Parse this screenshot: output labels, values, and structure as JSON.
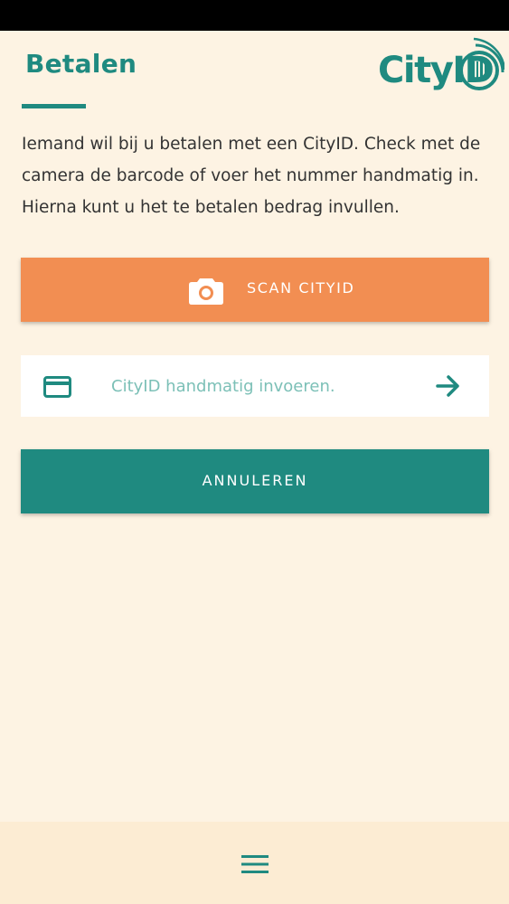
{
  "header": {
    "title": "Betalen",
    "logo_text": "CityID"
  },
  "intro_text": "Iemand wil bij u betalen met een CityID. Check met de camera de barcode of voer het nummer handmatig in. Hierna kunt u het te betalen bedrag invullen.",
  "scan_button": {
    "label": "SCAN CITYID",
    "icon": "camera-icon"
  },
  "manual_entry": {
    "placeholder": "CityID handmatig invoeren.",
    "value": "",
    "leading_icon": "credit-card-icon",
    "submit_icon": "arrow-right-icon"
  },
  "cancel_button": {
    "label": "ANNULEREN"
  },
  "bottom_bar": {
    "menu_icon": "hamburger-menu-icon"
  },
  "colors": {
    "background": "#fdf3e3",
    "primary_teal": "#1f8a80",
    "accent_orange": "#f28e52",
    "placeholder_teal": "#7cc0b7",
    "bottom_bar": "#fcecd3",
    "status_bar": "#000000"
  }
}
